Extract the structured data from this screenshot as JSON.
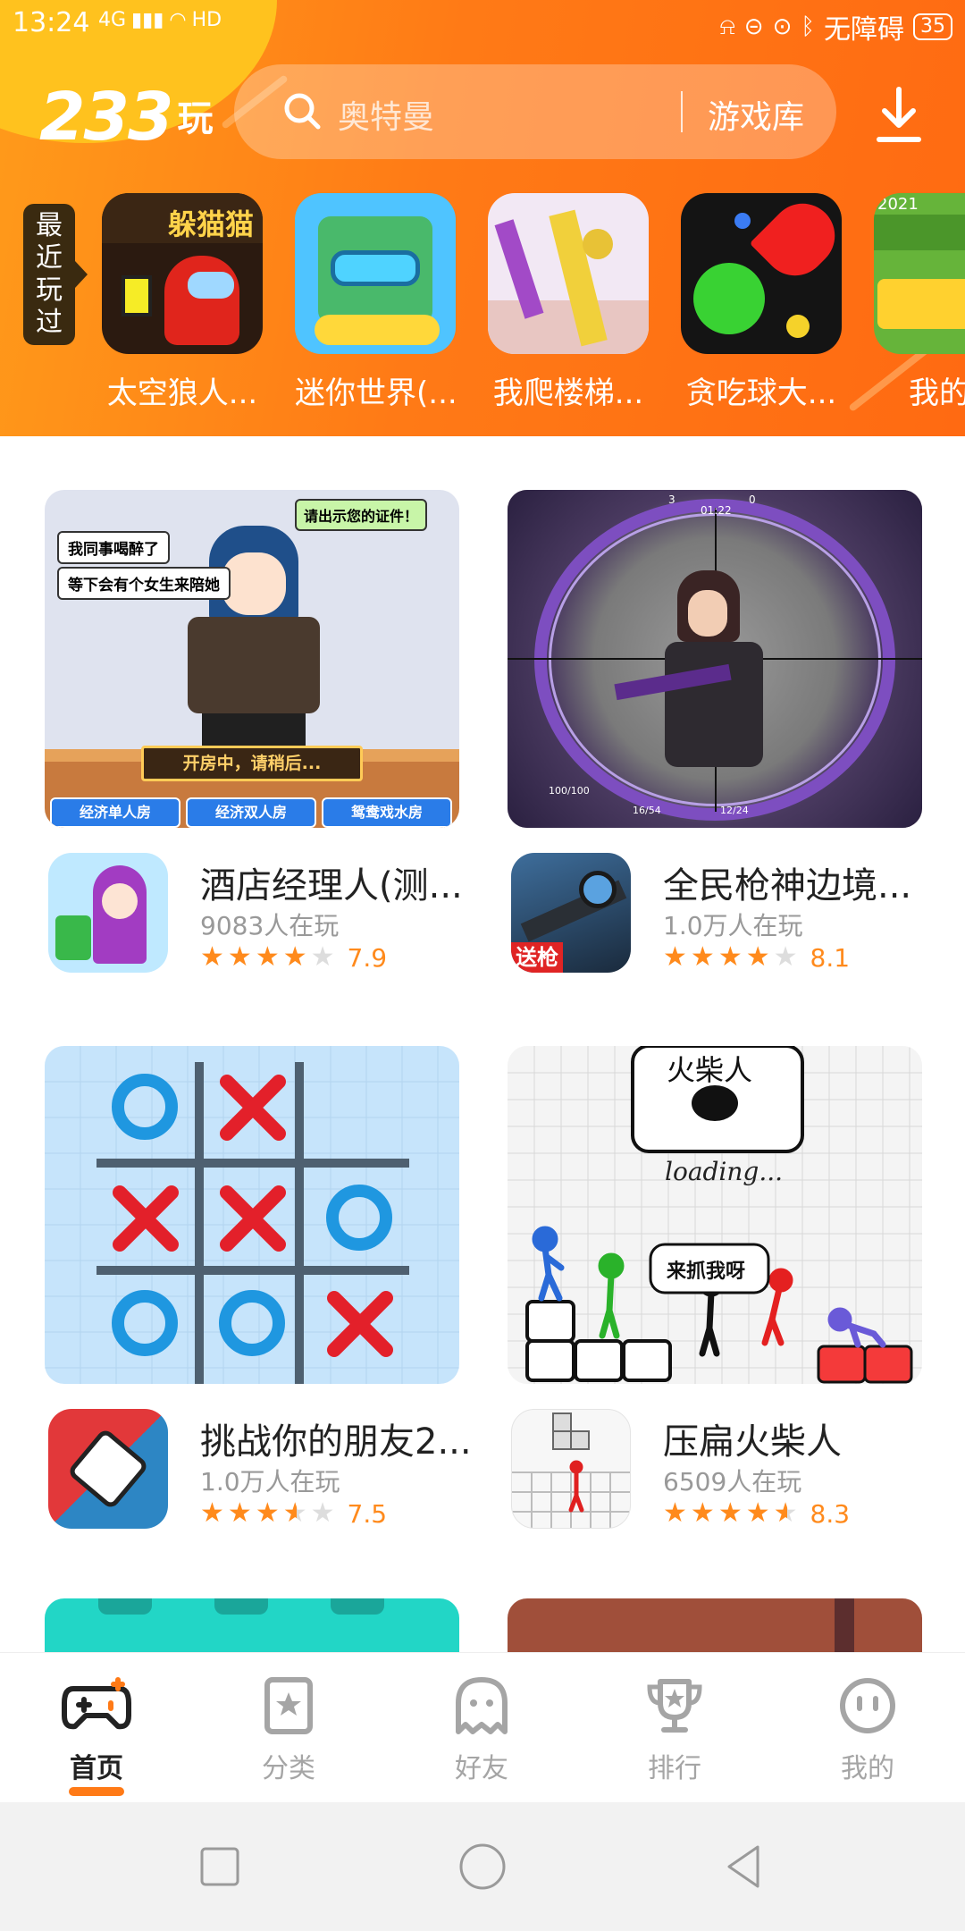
{
  "status_bar": {
    "time": "13:24",
    "network": "4G",
    "hd": "HD",
    "accessibility": "无障碍",
    "battery": "35"
  },
  "header": {
    "logo_number": "233",
    "logo_char": "玩",
    "search": {
      "placeholder": "奥特曼",
      "library_label": "游戏库"
    },
    "download_icon": "download-icon"
  },
  "recent": {
    "tag": [
      "最",
      "近",
      "玩",
      "过"
    ],
    "games": [
      {
        "name": "太空狼人...",
        "badge": "躲猫猫"
      },
      {
        "name": "迷你世界(..."
      },
      {
        "name": "我爬楼梯..."
      },
      {
        "name": "贪吃球大..."
      },
      {
        "name": "我的工",
        "badge": "2021"
      }
    ]
  },
  "games": [
    {
      "title": "酒店经理人(测...",
      "players": "9083人在玩",
      "score": "7.9",
      "rating": 4,
      "banner_texts": [
        "请出示您的证件！",
        "我同事喝醉了",
        "等下会有个女生来陪她",
        "开房中，请稍后...",
        "经济单人房",
        "经济双人房",
        "鸳鸯戏水房"
      ]
    },
    {
      "title": "全民枪神边境...",
      "players": "1.0万人在玩",
      "score": "8.1",
      "rating": 4,
      "icon_badge": "送枪",
      "banner_texts": [
        "3",
        "01:22",
        "0",
        "100/100",
        "16/54",
        "12/24"
      ]
    },
    {
      "title": "挑战你的朋友2...",
      "players": "1.0万人在玩",
      "score": "7.5",
      "rating": 3.5
    },
    {
      "title": "压扁火柴人",
      "players": "6509人在玩",
      "score": "8.3",
      "rating": 4.5,
      "banner_texts": [
        "火柴人",
        "loading...",
        "来抓我呀"
      ]
    }
  ],
  "tabs": [
    {
      "label": "首页",
      "icon": "gamepad-icon",
      "active": true
    },
    {
      "label": "分类",
      "icon": "category-icon"
    },
    {
      "label": "好友",
      "icon": "ghost-icon"
    },
    {
      "label": "排行",
      "icon": "trophy-icon"
    },
    {
      "label": "我的",
      "icon": "smiley-icon"
    }
  ],
  "colors": {
    "accent": "#ff7a16",
    "star": "#ff8a1c",
    "header_yellow": "#ffc21e"
  }
}
